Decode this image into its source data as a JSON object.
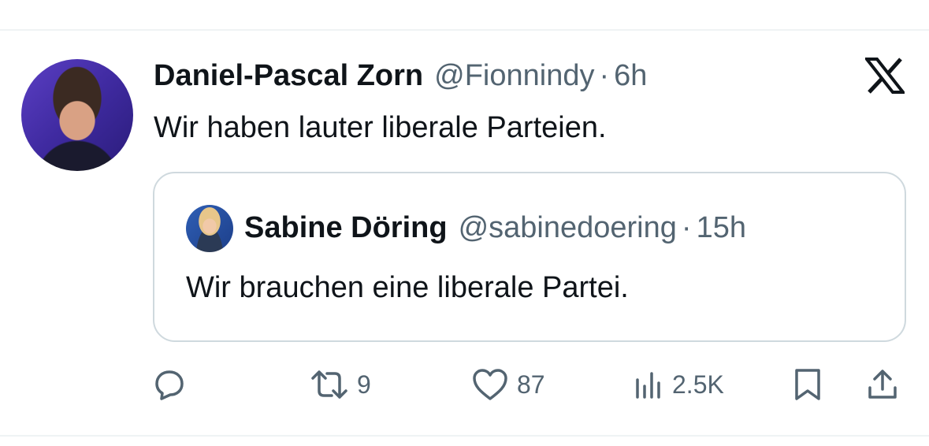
{
  "tweet": {
    "author": {
      "name": "Daniel-Pascal Zorn",
      "handle": "@Fionnindy",
      "separator": "·",
      "time": "6h"
    },
    "text": "Wir haben lauter liberale Parteien.",
    "quote": {
      "author": {
        "name": "Sabine Döring",
        "handle": "@sabinedoering",
        "separator": "·",
        "time": "15h"
      },
      "text": "Wir brauchen eine liberale Partei."
    },
    "metrics": {
      "retweets": "9",
      "likes": "87",
      "views": "2.5K"
    }
  },
  "icons": {
    "logo": "x-logo-icon",
    "reply": "reply-icon",
    "retweet": "retweet-icon",
    "like": "heart-icon",
    "views": "views-icon",
    "bookmark": "bookmark-icon",
    "share": "share-icon"
  },
  "colors": {
    "text": "#0f1419",
    "secondary": "#536471",
    "border": "#cfd9de"
  }
}
